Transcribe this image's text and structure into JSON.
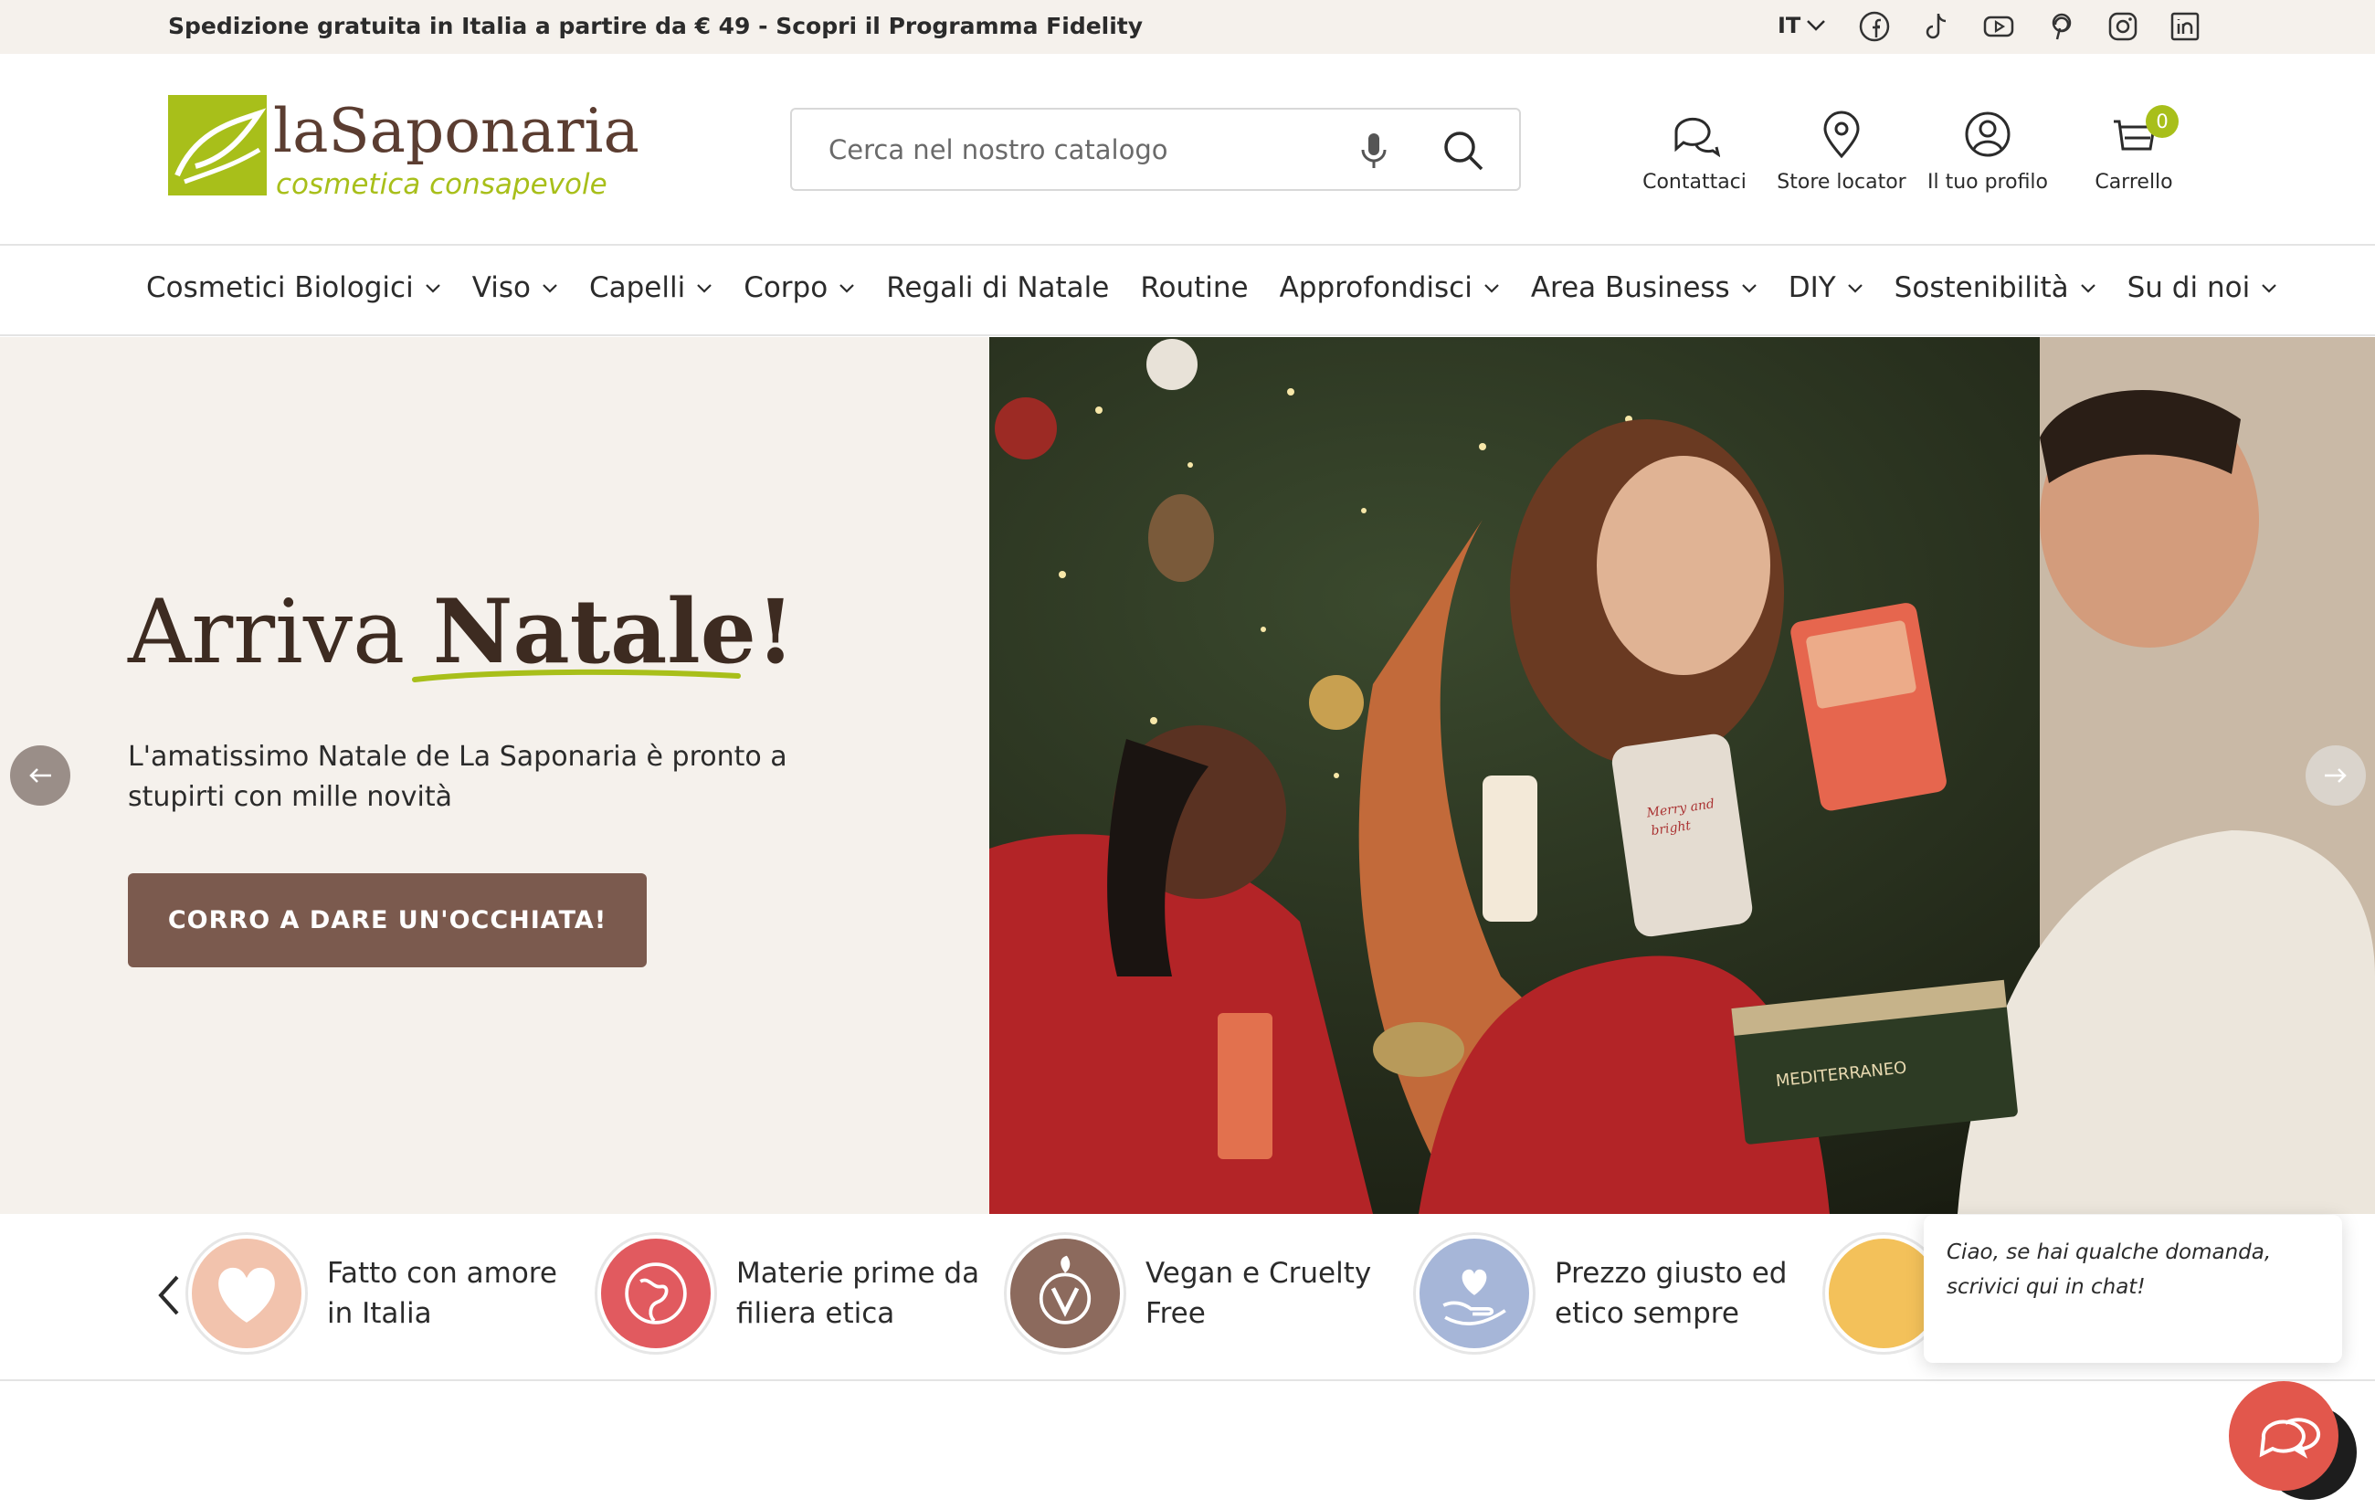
{
  "topbar": {
    "promo": "Spedizione gratuita  in Italia a partire da € 49 - Scopri il Programma Fidelity",
    "language": "IT",
    "social": [
      "facebook-icon",
      "tiktok-icon",
      "youtube-icon",
      "pinterest-icon",
      "instagram-icon",
      "linkedin-icon"
    ]
  },
  "header": {
    "logo_text": "laSaponaria",
    "logo_tagline": "cosmetica consapevole",
    "search_placeholder": "Cerca nel nostro catalogo",
    "icons": [
      {
        "label": "Contattaci",
        "icon": "chat-icon"
      },
      {
        "label": "Store locator",
        "icon": "location-pin-icon"
      },
      {
        "label": "Il tuo profilo",
        "icon": "user-icon"
      },
      {
        "label": "Carrello",
        "icon": "cart-icon",
        "count": "0"
      }
    ]
  },
  "nav": {
    "items": [
      {
        "label": "Cosmetici Biologici",
        "dropdown": true
      },
      {
        "label": "Viso",
        "dropdown": true
      },
      {
        "label": "Capelli",
        "dropdown": true
      },
      {
        "label": "Corpo",
        "dropdown": true
      },
      {
        "label": "Regali di Natale",
        "dropdown": false
      },
      {
        "label": "Routine",
        "dropdown": false
      },
      {
        "label": "Approfondisci",
        "dropdown": true
      },
      {
        "label": "Area Business",
        "dropdown": true
      },
      {
        "label": "DIY",
        "dropdown": true
      },
      {
        "label": "Sostenibilità",
        "dropdown": true
      },
      {
        "label": "Su di noi",
        "dropdown": true
      }
    ]
  },
  "hero": {
    "title_light": "Arriva",
    "title_bold": "Natale!",
    "subtitle": "L'amatissimo Natale de La Saponaria è pronto a stupirti con mille novità",
    "cta": "CORRO A DARE UN'OCCHIATA!"
  },
  "benefits": [
    {
      "text": "Fatto con amore in Italia",
      "color": "#f2c3ad"
    },
    {
      "text": "Materie prime da filiera etica",
      "color": "#e15a5f"
    },
    {
      "text": "Vegan e Cruelty Free",
      "color": "#8c6a5d"
    },
    {
      "text": "Prezzo giusto ed etico sempre",
      "color": "#a6b6d8"
    }
  ],
  "chat": {
    "message": "Ciao, se hai qualche domanda, scrivici qui in chat!"
  },
  "colors": {
    "brand_green": "#a8bf1a",
    "brand_brown": "#7b5a4e",
    "hero_bg": "#f5f1ec",
    "chat_red": "#e2574c"
  }
}
